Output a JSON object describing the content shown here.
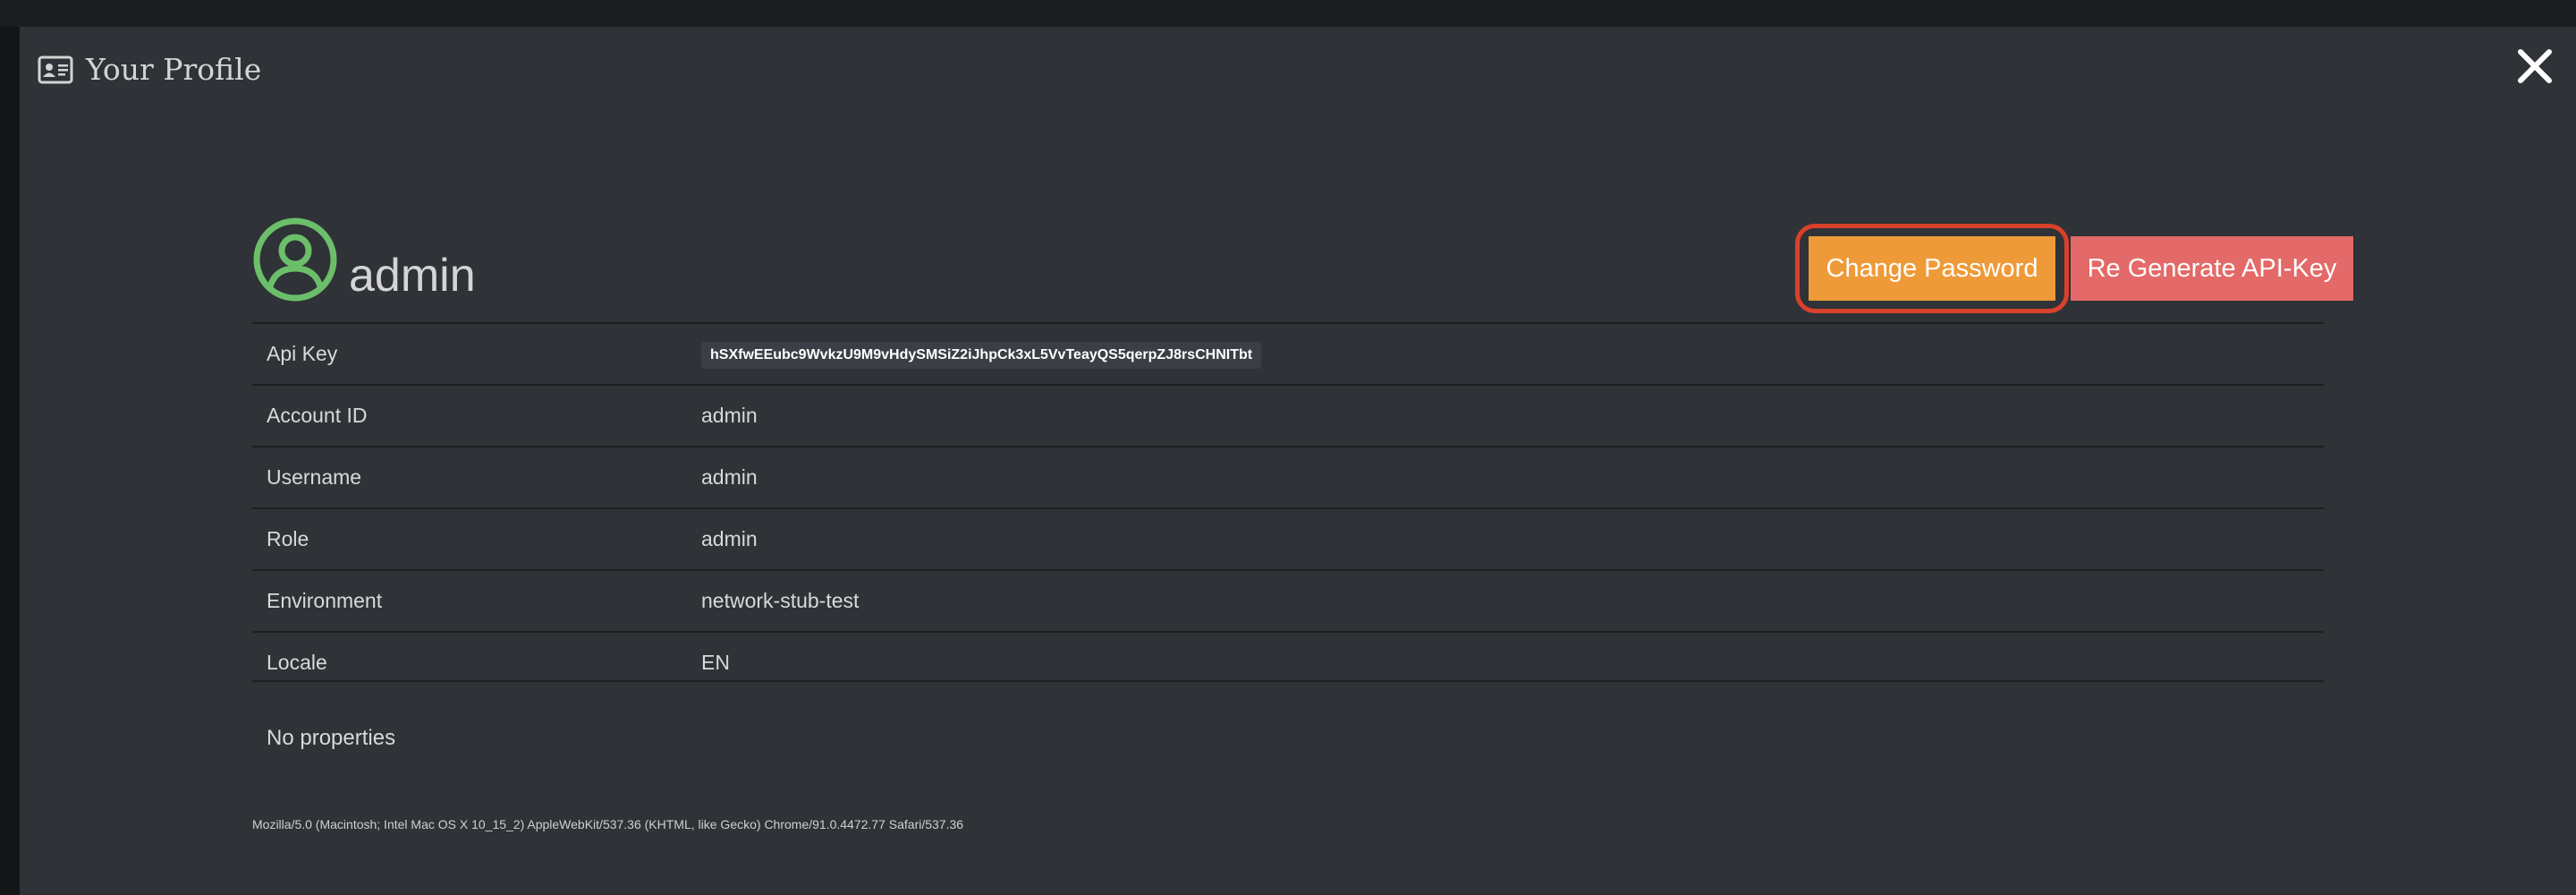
{
  "modal": {
    "title": "Your Profile",
    "close_icon": "close-icon",
    "title_icon": "id-card-icon"
  },
  "profile": {
    "avatar_icon": "user-circle-icon",
    "avatar_color": "#6cbf6a",
    "username": "admin",
    "actions": {
      "change_password": "Change Password",
      "regenerate_api_key": "Re Generate API-Key"
    },
    "fields": [
      {
        "label": "Api Key",
        "value": "hSXfwEEubc9WvkzU9M9vHdySMSiZ2iJhpCk3xL5VvTeayQS5qerpZJ8rsCHNITbt"
      },
      {
        "label": "Account ID",
        "value": "admin"
      },
      {
        "label": "Username",
        "value": "admin"
      },
      {
        "label": "Role",
        "value": "admin"
      },
      {
        "label": "Environment",
        "value": "network-stub-test"
      },
      {
        "label": "Locale",
        "value": "EN"
      }
    ],
    "properties_text": "No properties"
  },
  "footer": {
    "user_agent": "Mozilla/5.0 (Macintosh; Intel Mac OS X 10_15_2) AppleWebKit/537.36 (KHTML, like Gecko) Chrome/91.0.4472.77 Safari/537.36"
  },
  "colors": {
    "change_password_bg": "#ee9a38",
    "regenerate_bg": "#e36a68",
    "highlight_ring": "#d9412b",
    "modal_bg": "#2f3237"
  }
}
